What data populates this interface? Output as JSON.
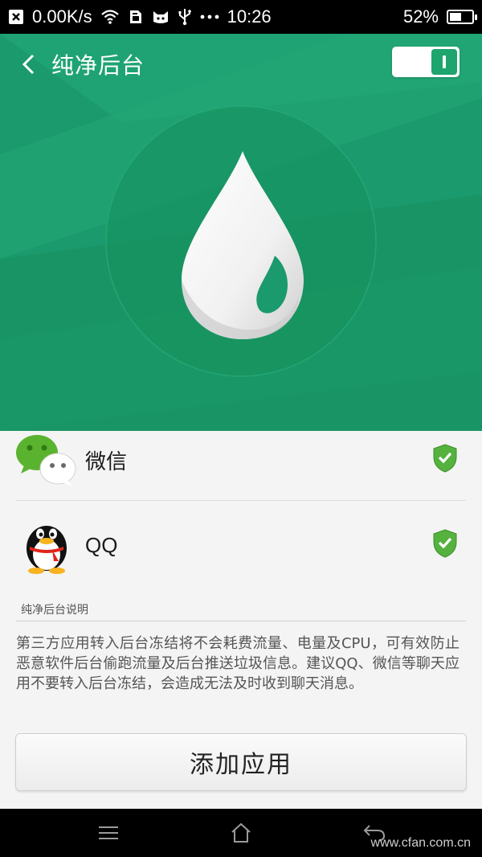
{
  "status_bar": {
    "speed": "0.00K/s",
    "time": "10:26",
    "battery_percent": "52%",
    "battery_level": 0.52,
    "icons": [
      "close-box-icon",
      "wifi-icon",
      "sim-card-icon",
      "cat-face-icon",
      "usb-icon",
      "more-dots-icon",
      "battery-icon"
    ]
  },
  "header": {
    "title": "纯净后台",
    "toggle_on": true,
    "accent_color": "#1b9a6d"
  },
  "apps": [
    {
      "name": "微信",
      "icon": "wechat-icon",
      "protected": true
    },
    {
      "name": "QQ",
      "icon": "qq-penguin-icon",
      "protected": true
    }
  ],
  "info": {
    "section_label": "纯净后台说明",
    "description": "第三方应用转入后台冻结将不会耗费流量、电量及CPU，可有效防止恶意软件后台偷跑流量及后台推送垃圾信息。建议QQ、微信等聊天应用不要转入后台冻结，会造成无法及时收到聊天消息。"
  },
  "add_button_label": "添加应用",
  "nav": {
    "icons": [
      "menu-icon",
      "home-icon",
      "back-icon"
    ],
    "watermark": "www.cfan.com.cn"
  }
}
